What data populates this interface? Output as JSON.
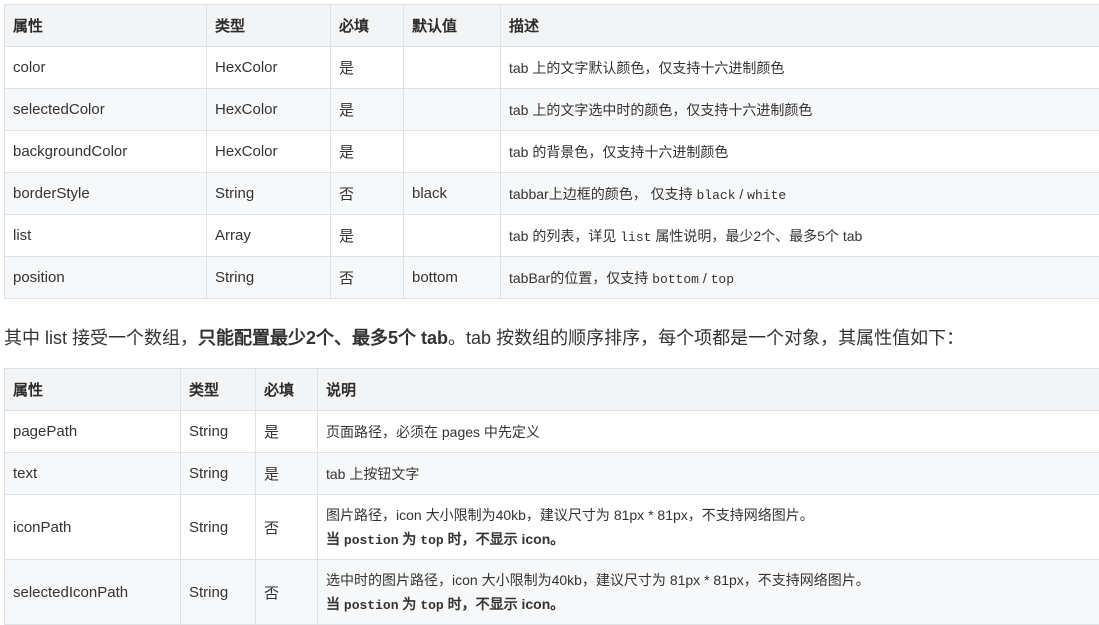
{
  "table1": {
    "headers": [
      "属性",
      "类型",
      "必填",
      "默认值",
      "描述"
    ],
    "rows": [
      {
        "name": "color",
        "type": "HexColor",
        "required": "是",
        "default": "",
        "desc": "tab 上的文字默认颜色，仅支持十六进制颜色"
      },
      {
        "name": "selectedColor",
        "type": "HexColor",
        "required": "是",
        "default": "",
        "desc": "tab 上的文字选中时的颜色，仅支持十六进制颜色"
      },
      {
        "name": "backgroundColor",
        "type": "HexColor",
        "required": "是",
        "default": "",
        "desc": "tab 的背景色，仅支持十六进制颜色"
      },
      {
        "name": "borderStyle",
        "type": "String",
        "required": "否",
        "default": "black",
        "desc_pre": "tabbar上边框的颜色， 仅支持 ",
        "desc_code1": "black",
        "desc_sep": " / ",
        "desc_code2": "white"
      },
      {
        "name": "list",
        "type": "Array",
        "required": "是",
        "default": "",
        "desc_pre": "tab 的列表，详见 ",
        "desc_code": "list",
        "desc_post": " 属性说明，最少2个、最多5个 tab"
      },
      {
        "name": "position",
        "type": "String",
        "required": "否",
        "default": "bottom",
        "desc_pre": "tabBar的位置，仅支持 ",
        "desc_code1": "bottom",
        "desc_sep": " / ",
        "desc_code2": "top"
      }
    ]
  },
  "paragraph": {
    "pre": "其中 list 接受一个数组，",
    "bold": "只能配置最少2个、最多5个 tab",
    "post": "。tab 按数组的顺序排序，每个项都是一个对象，其属性值如下："
  },
  "table2": {
    "headers": [
      "属性",
      "类型",
      "必填",
      "说明"
    ],
    "rows": [
      {
        "name": "pagePath",
        "type": "String",
        "required": "是",
        "desc": "页面路径，必须在 pages 中先定义"
      },
      {
        "name": "text",
        "type": "String",
        "required": "是",
        "desc": "tab 上按钮文字"
      },
      {
        "name": "iconPath",
        "type": "String",
        "required": "否",
        "desc": "图片路径，icon 大小限制为40kb，建议尺寸为 81px * 81px，不支持网络图片。",
        "note_pre": "当 ",
        "note_code1": "postion",
        "note_mid": " 为 ",
        "note_code2": "top",
        "note_post": " 时，不显示 icon。"
      },
      {
        "name": "selectedIconPath",
        "type": "String",
        "required": "否",
        "desc": "选中时的图片路径，icon 大小限制为40kb，建议尺寸为 81px * 81px，不支持网络图片。",
        "note_pre": "当 ",
        "note_code1": "postion",
        "note_mid": " 为 ",
        "note_code2": "top",
        "note_post": " 时，不显示 icon。"
      }
    ]
  }
}
